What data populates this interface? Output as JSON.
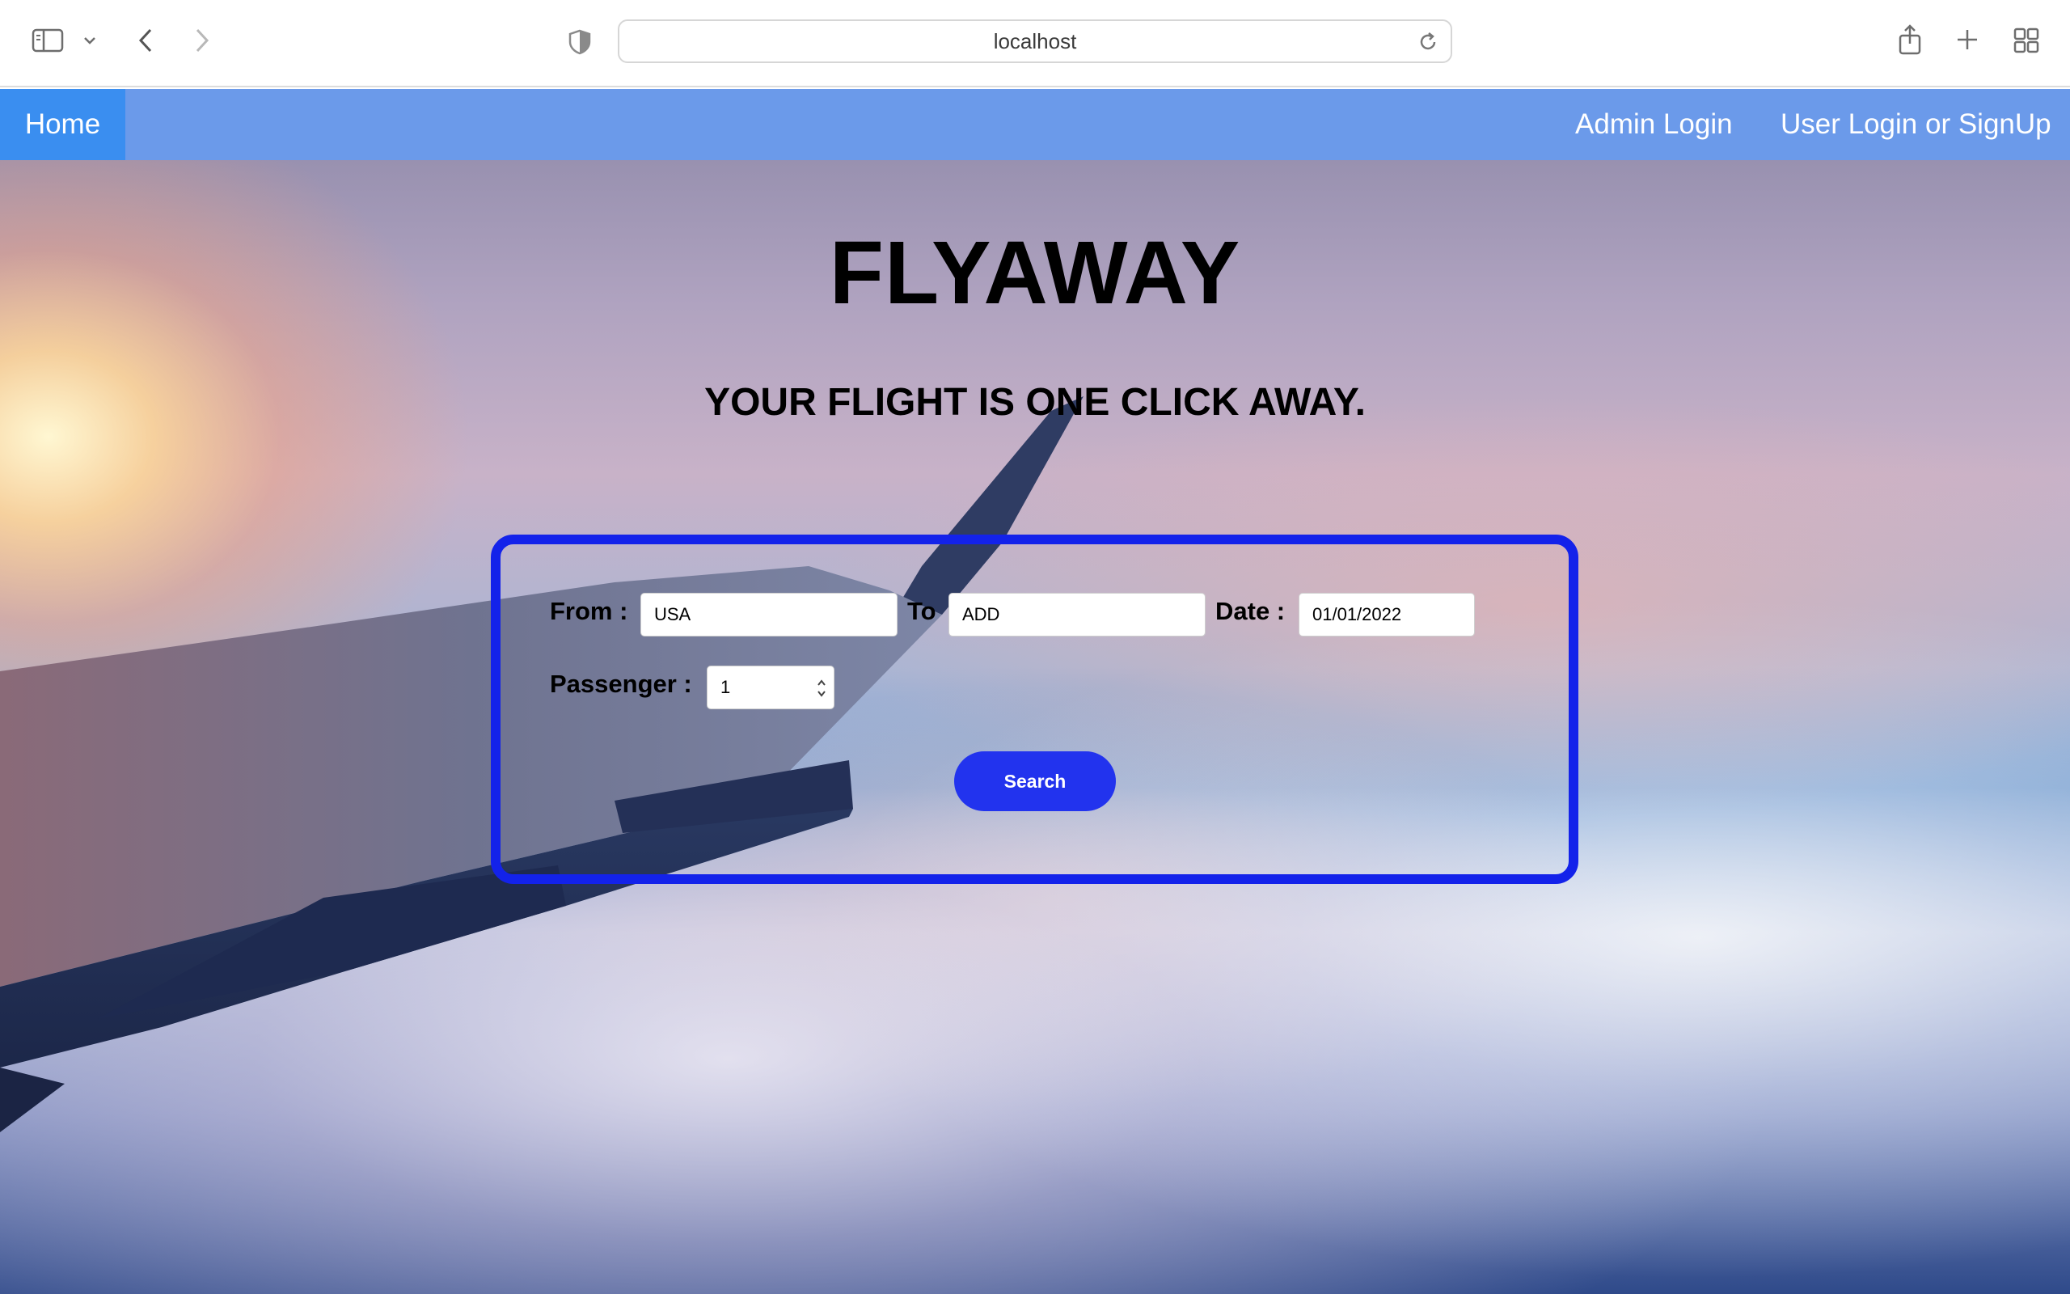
{
  "browser": {
    "url": "localhost",
    "icons": [
      "sidebar-icon",
      "chevron-down-icon",
      "back-icon",
      "forward-icon",
      "shield-icon",
      "reload-icon",
      "share-icon",
      "new-tab-icon",
      "tab-overview-icon"
    ]
  },
  "nav": {
    "home": "Home",
    "admin_login": "Admin Login",
    "user_login": "User Login or SignUp"
  },
  "hero": {
    "title": "FLYAWAY",
    "subtitle": "YOUR FLIGHT IS ONE CLICK AWAY."
  },
  "form": {
    "from_label": "From :",
    "from_value": "USA",
    "to_label": "To",
    "to_value": "ADD",
    "date_label": "Date :",
    "date_value": "01/01/2022",
    "passenger_label": "Passenger :",
    "passenger_value": "1",
    "search_label": "Search"
  },
  "colors": {
    "navbar": "#6b9aea",
    "home_active": "#3a8ef0",
    "form_border": "#1322ea",
    "button": "#2233ee"
  }
}
